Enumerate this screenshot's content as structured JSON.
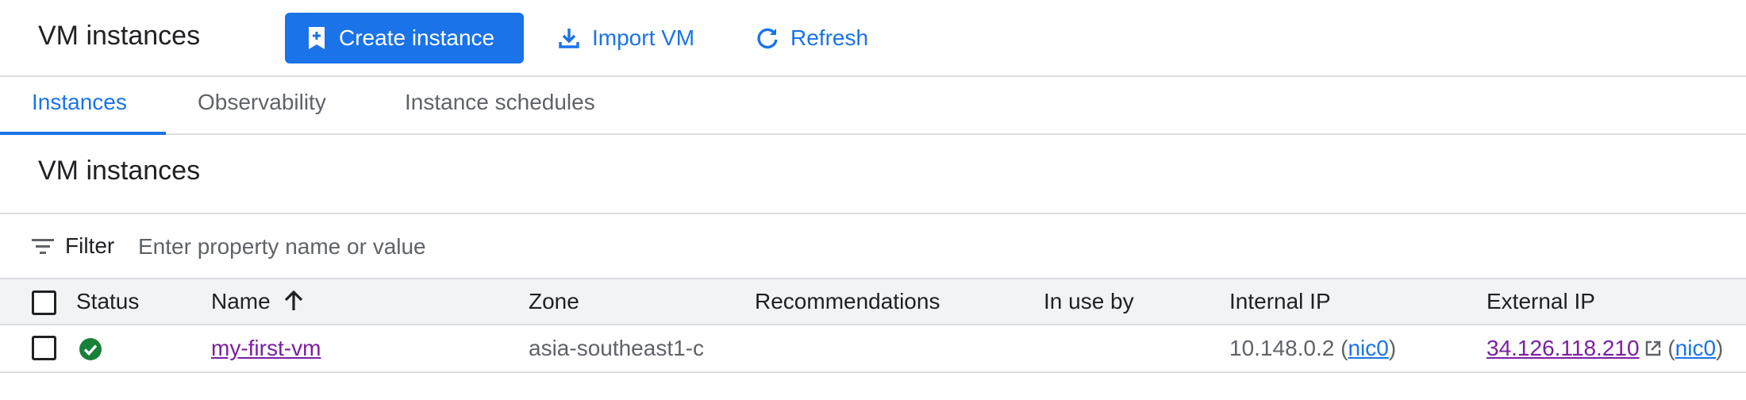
{
  "header": {
    "title": "VM instances",
    "create_label": "Create instance",
    "import_label": "Import VM",
    "refresh_label": "Refresh"
  },
  "tabs": [
    {
      "label": "Instances",
      "active": true
    },
    {
      "label": "Observability",
      "active": false
    },
    {
      "label": "Instance schedules",
      "active": false
    }
  ],
  "section_title": "VM instances",
  "filter": {
    "label": "Filter",
    "placeholder": "Enter property name or value"
  },
  "table": {
    "columns": [
      "Status",
      "Name",
      "Zone",
      "Recommendations",
      "In use by",
      "Internal IP",
      "External IP"
    ],
    "rows": [
      {
        "status": "running",
        "name": "my-first-vm",
        "zone": "asia-southeast1-c",
        "recommendations": "",
        "in_use_by": "",
        "internal_ip": "10.148.0.2",
        "internal_nic": "nic0",
        "external_ip": "34.126.118.210",
        "external_nic": "nic0"
      }
    ]
  },
  "icons": {
    "create": "add-box-icon",
    "import": "download-icon",
    "refresh": "refresh-icon",
    "filter": "filter-list-icon",
    "sort": "arrow-up-icon",
    "status": "check-circle-icon",
    "external": "open-in-new-icon"
  },
  "colors": {
    "primary": "#1a73e8",
    "link_visited": "#7b1fa2",
    "status_ok": "#188038",
    "header_bg": "#f1f3f4"
  }
}
